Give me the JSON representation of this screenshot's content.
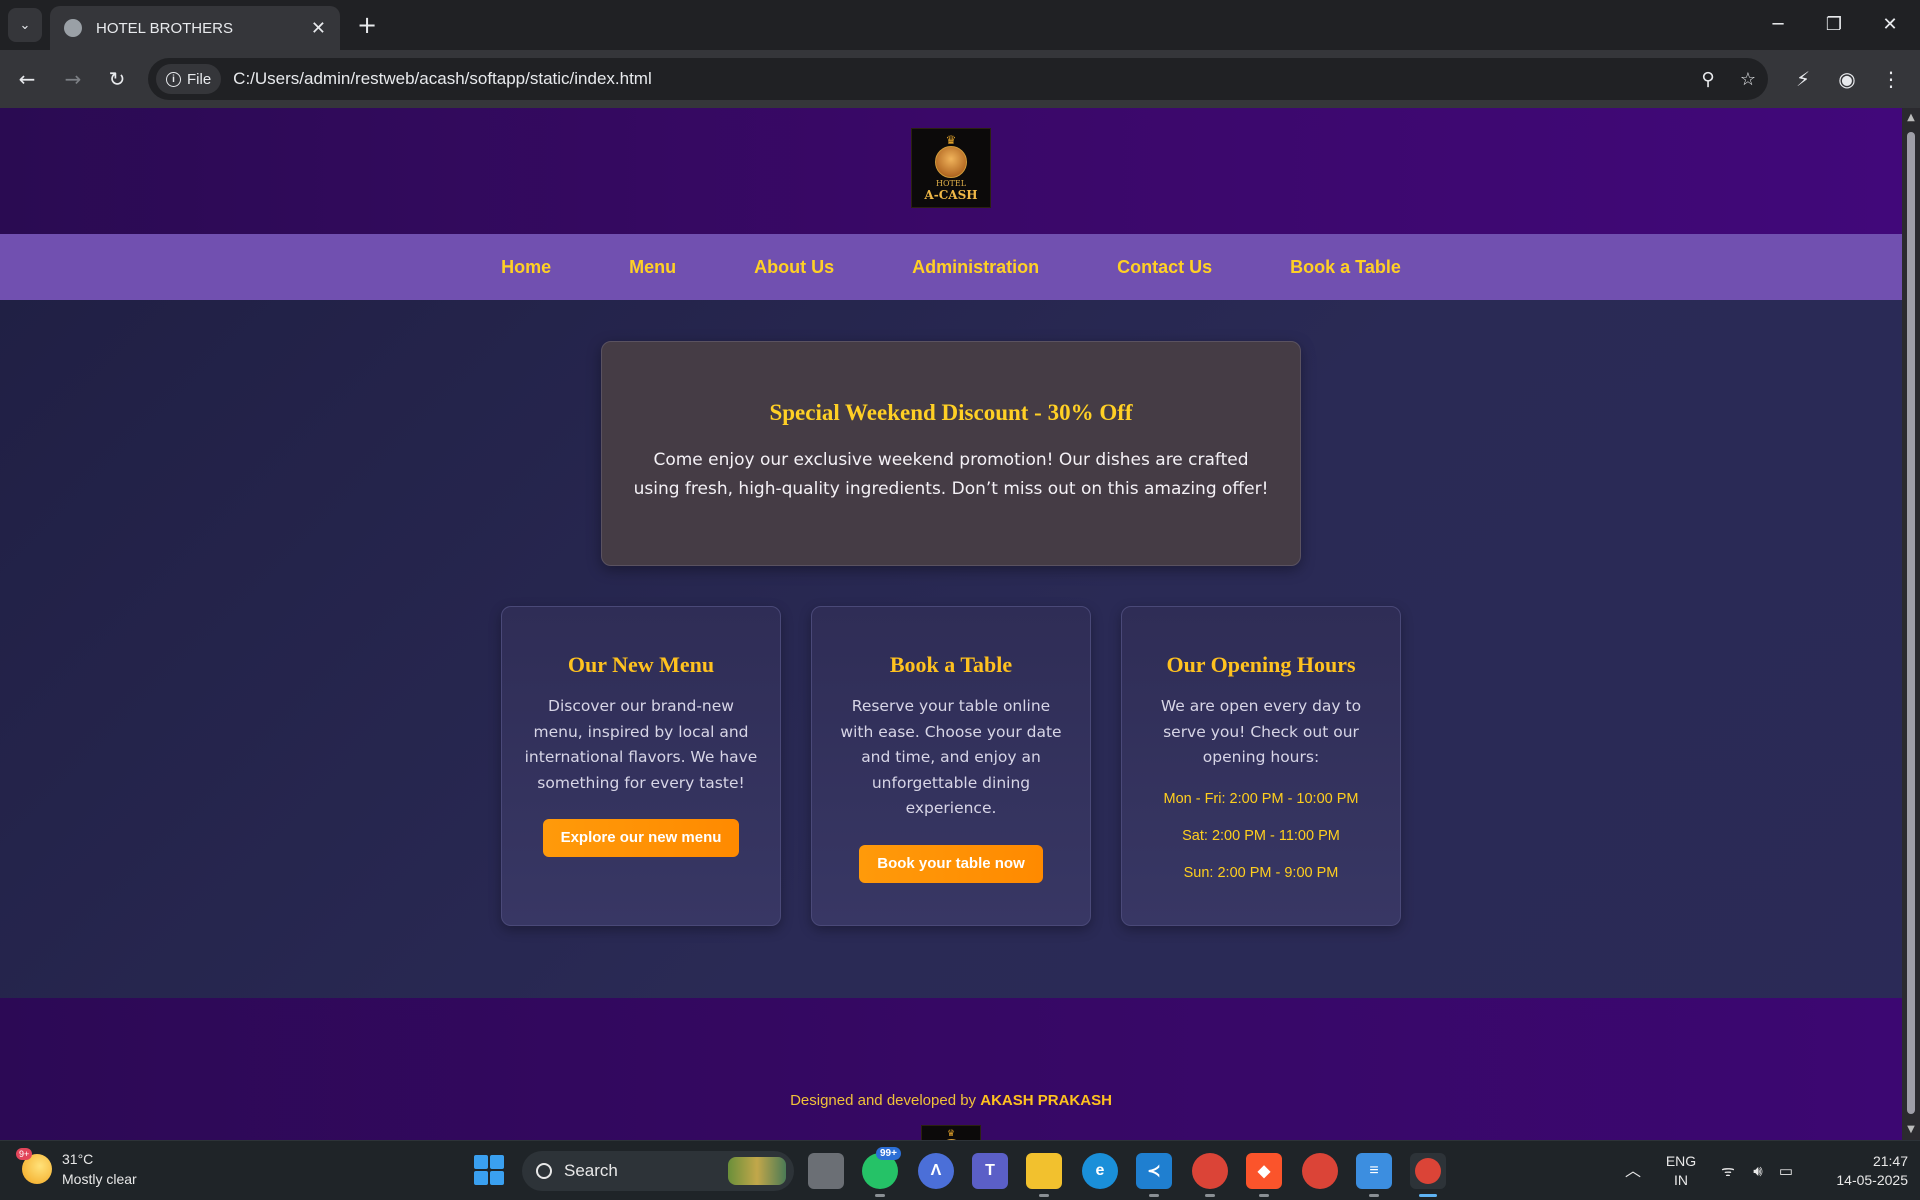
{
  "browser": {
    "tab_title": "HOTEL BROTHERS",
    "url_chip": "File",
    "url": "C:/Users/admin/restweb/acash/softapp/static/index.html"
  },
  "site": {
    "logo": {
      "line1": "HOTEL",
      "line2": "A-CASH"
    },
    "nav": [
      "Home",
      "Menu",
      "About Us",
      "Administration",
      "Contact Us",
      "Book a Table"
    ],
    "promo": {
      "title": "Special Weekend Discount - 30% Off",
      "text": "Come enjoy our exclusive weekend promotion! Our dishes are crafted using fresh, high-quality ingredients. Don’t miss out on this amazing offer!"
    },
    "cards": [
      {
        "title": "Our New Menu",
        "text": "Discover our brand-new menu, inspired by local and international flavors. We have something for every taste!",
        "button": "Explore our new menu"
      },
      {
        "title": "Book a Table",
        "text": "Reserve your table online with ease. Choose your date and time, and enjoy an unforgettable dining experience.",
        "button": "Book your table now"
      },
      {
        "title": "Our Opening Hours",
        "text": "We are open every day to serve you! Check out our opening hours:",
        "hours": [
          "Mon - Fri: 2:00 PM - 10:00 PM",
          "Sat: 2:00 PM - 11:00 PM",
          "Sun: 2:00 PM - 9:00 PM"
        ]
      }
    ],
    "footer": {
      "credit_prefix": "Designed and developed by",
      "credit_name": "AKASH PRAKASH"
    }
  },
  "taskbar": {
    "weather": {
      "badge": "9+",
      "temp": "31°C",
      "condition": "Mostly clear"
    },
    "search_placeholder": "Search",
    "whatsapp_badge": "99+",
    "lang": {
      "line1": "ENG",
      "line2": "IN"
    },
    "time": "21:47",
    "date": "14-05-2025"
  },
  "colors": {
    "accent_gold": "#ffd025",
    "nav_bg": "#7150b0",
    "header_bg": "#3a0868",
    "button_orange": "#ff9a0a"
  }
}
